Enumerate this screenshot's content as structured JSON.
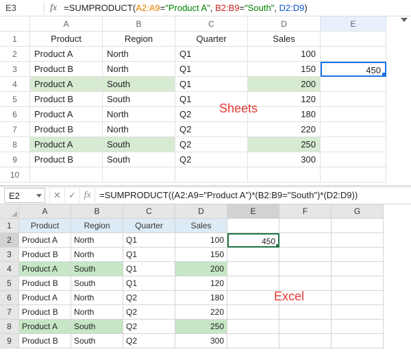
{
  "sheets": {
    "cell_ref": "E3",
    "fx_label": "fx",
    "formula_tokens": {
      "fn": "=SUMPRODUCT",
      "open": "(",
      "r1": "A2:A9",
      "eq1": "=",
      "s1": "\"Product A\"",
      "c1": ", ",
      "r2": "B2:B9",
      "eq2": "=",
      "s2": "\"South\"",
      "c2": ", ",
      "r3": "D2:D9",
      "close": ")"
    },
    "col_headers": [
      "A",
      "B",
      "C",
      "D",
      "E"
    ],
    "row_headers": [
      "1",
      "2",
      "3",
      "4",
      "5",
      "6",
      "7",
      "8",
      "9",
      "10"
    ],
    "headers": {
      "product": "Product",
      "region": "Region",
      "quarter": "Quarter",
      "sales": "Sales"
    },
    "rows": [
      {
        "p": "Product A",
        "r": "North",
        "q": "Q1",
        "s": "100",
        "hl": false
      },
      {
        "p": "Product B",
        "r": "North",
        "q": "Q1",
        "s": "150",
        "hl": false
      },
      {
        "p": "Product A",
        "r": "South",
        "q": "Q1",
        "s": "200",
        "hl": true
      },
      {
        "p": "Product B",
        "r": "South",
        "q": "Q1",
        "s": "120",
        "hl": false
      },
      {
        "p": "Product A",
        "r": "North",
        "q": "Q2",
        "s": "180",
        "hl": false
      },
      {
        "p": "Product B",
        "r": "North",
        "q": "Q2",
        "s": "220",
        "hl": false
      },
      {
        "p": "Product A",
        "r": "South",
        "q": "Q2",
        "s": "250",
        "hl": true
      },
      {
        "p": "Product B",
        "r": "South",
        "q": "Q2",
        "s": "300",
        "hl": false
      }
    ],
    "result": "450",
    "label": "Sheets"
  },
  "excel": {
    "cell_ref": "E2",
    "btn_cancel": "✕",
    "btn_confirm": "✓",
    "fx_label": "fx",
    "formula": "=SUMPRODUCT((A2:A9=\"Product A\")*(B2:B9=\"South\")*(D2:D9))",
    "col_headers": [
      "A",
      "B",
      "C",
      "D",
      "E",
      "F",
      "G"
    ],
    "row_headers": [
      "1",
      "2",
      "3",
      "4",
      "5",
      "6",
      "7",
      "8",
      "9"
    ],
    "headers": {
      "product": "Product",
      "region": "Region",
      "quarter": "Quarter",
      "sales": "Sales"
    },
    "rows": [
      {
        "p": "Product A",
        "r": "North",
        "q": "Q1",
        "s": "100",
        "hl": false
      },
      {
        "p": "Product B",
        "r": "North",
        "q": "Q1",
        "s": "150",
        "hl": false
      },
      {
        "p": "Product A",
        "r": "South",
        "q": "Q1",
        "s": "200",
        "hl": true
      },
      {
        "p": "Product B",
        "r": "South",
        "q": "Q1",
        "s": "120",
        "hl": false
      },
      {
        "p": "Product A",
        "r": "North",
        "q": "Q2",
        "s": "180",
        "hl": false
      },
      {
        "p": "Product B",
        "r": "North",
        "q": "Q2",
        "s": "220",
        "hl": false
      },
      {
        "p": "Product A",
        "r": "South",
        "q": "Q2",
        "s": "250",
        "hl": true
      },
      {
        "p": "Product B",
        "r": "South",
        "q": "Q2",
        "s": "300",
        "hl": false
      }
    ],
    "result": "450",
    "label": "Excel"
  }
}
